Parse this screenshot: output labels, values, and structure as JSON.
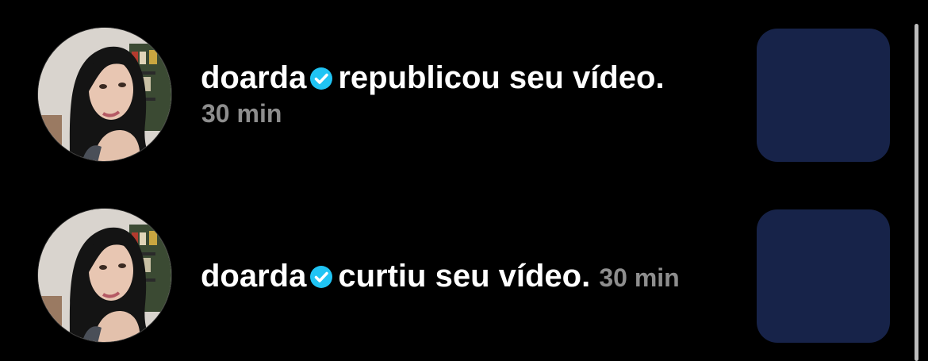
{
  "notifications": [
    {
      "username": "doarda",
      "verified": true,
      "action": "republicou seu vídeo.",
      "time": "30 min",
      "thumbnail_color": "#172349"
    },
    {
      "username": "doarda",
      "verified": true,
      "action": "curtiu seu vídeo.",
      "time": "30 min",
      "thumbnail_color": "#172349"
    }
  ],
  "colors": {
    "background": "#000000",
    "text": "#ffffff",
    "time": "#8e8e8e",
    "verified_badge": "#20c4f4",
    "thumbnail": "#172349"
  },
  "icons": {
    "verified": "verified-badge-icon"
  }
}
